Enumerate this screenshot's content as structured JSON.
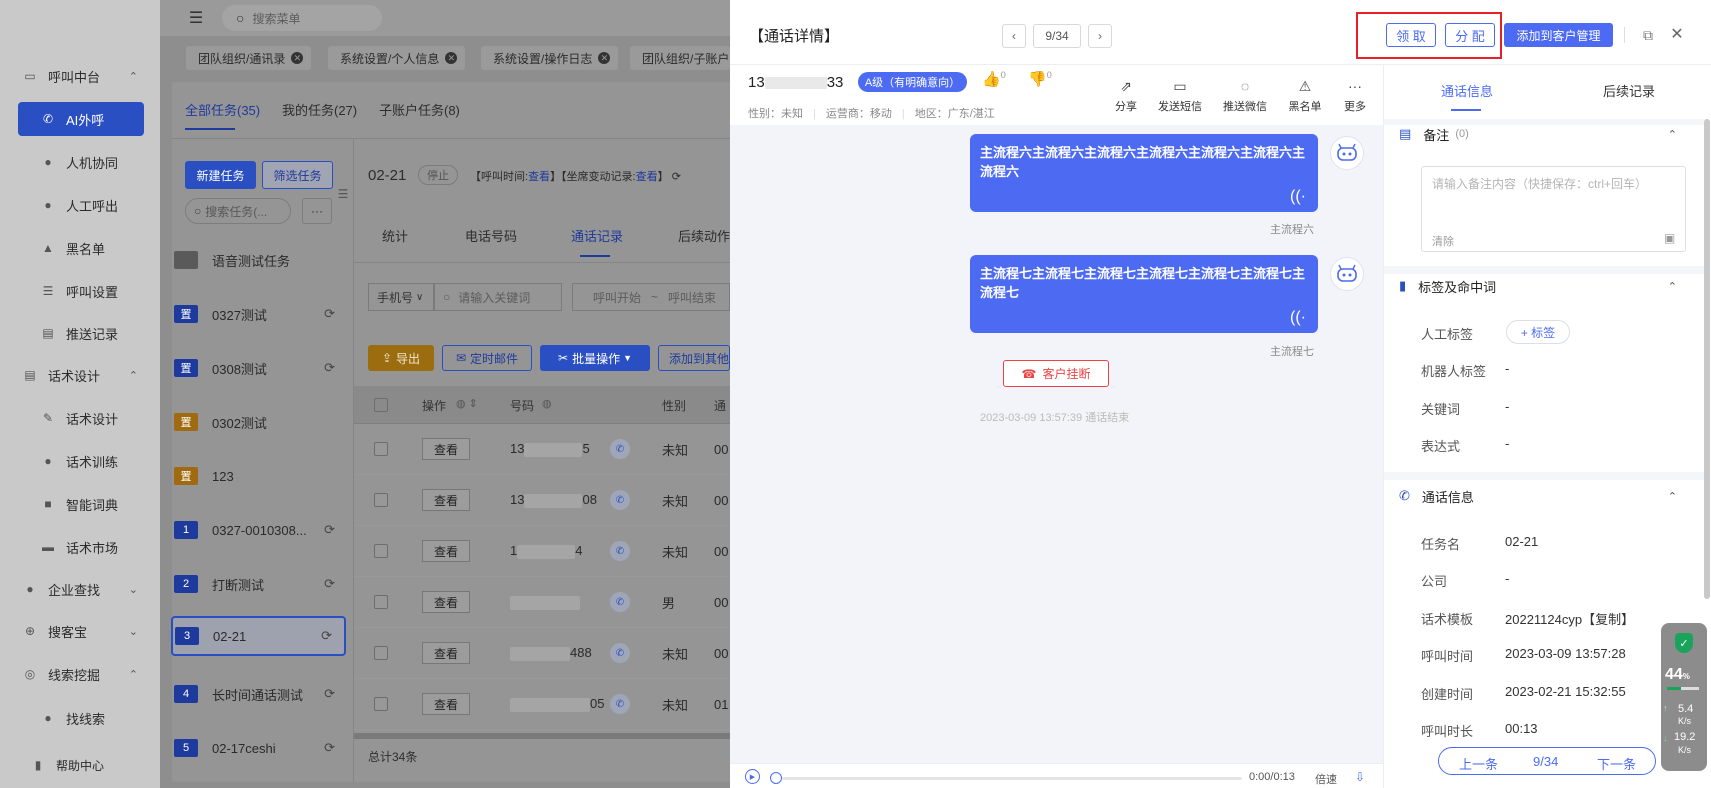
{
  "sidebar": {
    "items": [
      {
        "label": "呼叫中台",
        "icon": "monitor-icon",
        "group": true
      },
      {
        "label": "AI外呼",
        "icon": "phone-icon",
        "active": true
      },
      {
        "label": "人机协同",
        "icon": "user-icon"
      },
      {
        "label": "人工呼出",
        "icon": "users-icon"
      },
      {
        "label": "黑名单",
        "icon": "warning-icon"
      },
      {
        "label": "呼叫设置",
        "icon": "sliders-icon"
      },
      {
        "label": "推送记录",
        "icon": "doc-icon"
      },
      {
        "label": "话术设计",
        "icon": "doc-icon",
        "group": true
      },
      {
        "label": "话术设计",
        "icon": "pen-icon"
      },
      {
        "label": "话术训练",
        "icon": "chat-icon"
      },
      {
        "label": "智能词典",
        "icon": "book-icon"
      },
      {
        "label": "话术市场",
        "icon": "store-icon"
      },
      {
        "label": "企业查找",
        "icon": "bulb-icon",
        "group": true
      },
      {
        "label": "搜客宝",
        "icon": "search-icon",
        "group": true
      },
      {
        "label": "线索挖掘",
        "icon": "target-icon",
        "group": true
      },
      {
        "label": "找线索",
        "icon": "search-icon"
      }
    ],
    "help": "帮助中心"
  },
  "topbar": {
    "search_placeholder": "搜索菜单"
  },
  "open_tabs": [
    "团队组织/通讯录",
    "系统设置/个人信息",
    "系统设置/操作日志",
    "团队组织/子账户"
  ],
  "task_tabs": [
    "全部任务(35)",
    "我的任务(27)",
    "子账户任务(8)"
  ],
  "task_buttons": {
    "new": "新建任务",
    "filter": "筛选任务",
    "search_placeholder": "搜索任务(...",
    "more": "···"
  },
  "tasks": [
    {
      "badge": "",
      "name": "语音测试任务"
    },
    {
      "badge": "置",
      "name": "0327测试"
    },
    {
      "badge": "置",
      "name": "0308测试"
    },
    {
      "badge": "置",
      "name": "0302测试"
    },
    {
      "badge": "置",
      "name": "123"
    },
    {
      "badge": "1",
      "name": "0327-0010308..."
    },
    {
      "badge": "2",
      "name": "打断测试"
    },
    {
      "badge": "3",
      "name": "02-21"
    },
    {
      "badge": "4",
      "name": "长时间通话测试"
    },
    {
      "badge": "5",
      "name": "02-17ceshi"
    }
  ],
  "task_detail": {
    "name": "02-21",
    "status": "停止",
    "call_time_label": "【呼叫时间:",
    "call_time_link": "查看",
    "seat_label": "】【坐席变动记录:",
    "seat_link": "查看",
    "seat_end": "】",
    "subtabs": [
      "统计",
      "电话号码",
      "通话记录",
      "后续动作"
    ],
    "phone_select": "手机号",
    "keyword_placeholder": "请输入关键词",
    "call_start": "呼叫开始",
    "call_tilde": "~",
    "call_end": "呼叫结束",
    "export": "导出",
    "timed_mail": "定时邮件",
    "batch": "批量操作",
    "add_other": "添加到其他",
    "columns": [
      "操作",
      "号码",
      "性别",
      "通"
    ],
    "rows": [
      {
        "action": "查看",
        "num_pre": "13",
        "num_suf": "5",
        "sex": "未知",
        "more": "00"
      },
      {
        "action": "查看",
        "num_pre": "13",
        "num_suf": "08",
        "sex": "未知",
        "more": "00"
      },
      {
        "action": "查看",
        "num_pre": "1",
        "num_suf": "4",
        "sex": "未知",
        "more": "00"
      },
      {
        "action": "查看",
        "num_pre": "",
        "num_suf": "",
        "sex": "男",
        "more": "00"
      },
      {
        "action": "查看",
        "num_pre": "",
        "num_suf": "488",
        "sex": "未知",
        "more": "00"
      },
      {
        "action": "查看",
        "num_pre": "",
        "num_suf": "05",
        "sex": "未知",
        "more": "01"
      }
    ],
    "total": "总计34条"
  },
  "drawer": {
    "title": "【通话详情】",
    "pager": "9/34",
    "claim": "领 取",
    "assign": "分 配",
    "add_customer": "添加到客户管理",
    "phone_pre": "13",
    "phone_suf": "33",
    "level": "A级（有明确意向）",
    "like_count": "0",
    "dislike_count": "0",
    "gender": "性别：未知",
    "carrier": "运营商：移动",
    "region": "地区：广东/湛江",
    "actions": [
      "分享",
      "发送短信",
      "推送微信",
      "黑名单",
      "更多"
    ],
    "messages": [
      {
        "text": "主流程六主流程六主流程六主流程六主流程六主流程六主流程六",
        "caption": "主流程六"
      },
      {
        "text": "主流程七主流程七主流程七主流程七主流程七主流程七主流程七",
        "caption": "主流程七"
      }
    ],
    "hangup": "客户挂断",
    "end_note": "2023-03-09 13:57:39 通话结束",
    "audio_time": "0:00/0:13",
    "speed": "倍速"
  },
  "right_panel": {
    "tabs": [
      "通话信息",
      "后续记录"
    ],
    "remark_title": "备注",
    "remark_count": "(0)",
    "remark_placeholder": "请输入备注内容（快捷保存：ctrl+回车）",
    "remark_clear": "清除",
    "tags_title": "标签及命中词",
    "tags": [
      {
        "k": "人工标签",
        "v": "+ 标签"
      },
      {
        "k": "机器人标签",
        "v": "-"
      },
      {
        "k": "关键词",
        "v": "-"
      },
      {
        "k": "表达式",
        "v": "-"
      }
    ],
    "call_info_title": "通话信息",
    "call_info": [
      {
        "k": "任务名",
        "v": "02-21"
      },
      {
        "k": "公司",
        "v": "-"
      },
      {
        "k": "话术模板",
        "v": "20221124cyp【复制】"
      },
      {
        "k": "呼叫时间",
        "v": "2023-03-09 13:57:28"
      },
      {
        "k": "创建时间",
        "v": "2023-02-21 15:32:55"
      },
      {
        "k": "呼叫时长",
        "v": "00:13"
      }
    ],
    "prev": "上一条",
    "page": "9/34",
    "next": "下一条"
  },
  "net_widget": {
    "percent": "44",
    "percent_unit": "%",
    "up": "5.4",
    "up_unit": "K/s",
    "down": "19.2",
    "down_unit": "K/s"
  },
  "colors": {
    "accent": "#4c6bf2",
    "highlight_box": "#e8202a",
    "hangup_red": "#e84545"
  }
}
